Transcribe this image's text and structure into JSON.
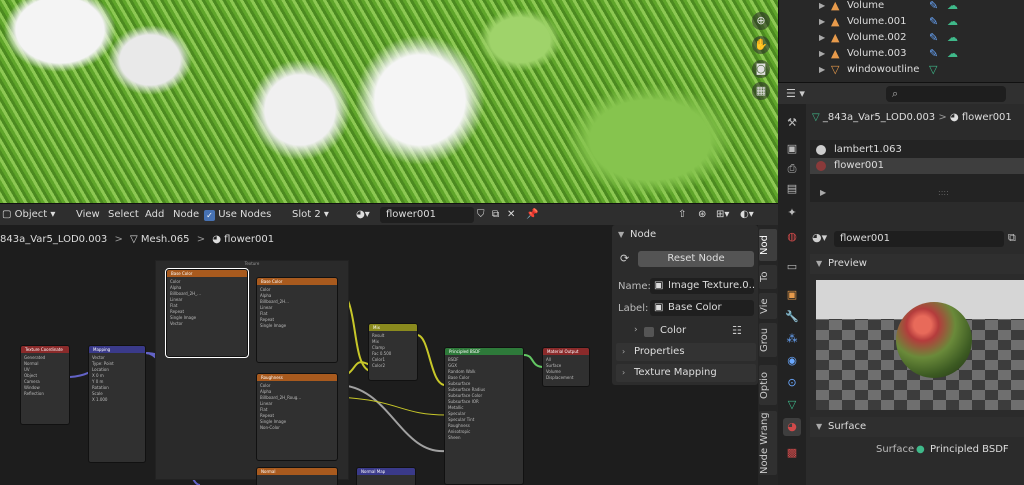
{
  "outliner": {
    "items": [
      {
        "label": "Volume"
      },
      {
        "label": "Volume.001"
      },
      {
        "label": "Volume.002"
      },
      {
        "label": "Volume.003"
      },
      {
        "label": "windowoutline"
      }
    ]
  },
  "properties": {
    "search_placeholder": "",
    "path_object": "_843a_Var5_LOD0.003",
    "path_material": "flower001",
    "materials": [
      {
        "name": "lambert1.063",
        "color": "#cccccc"
      },
      {
        "name": "flower001",
        "color": "#8a3a3a"
      }
    ],
    "material_slot": "flower001",
    "preview_label": "Preview",
    "surface_section": "Surface",
    "surface_label": "Surface",
    "surface_value": "Principled BSDF"
  },
  "node_editor": {
    "mode": "Object",
    "menu": [
      "View",
      "Select",
      "Add",
      "Node"
    ],
    "use_nodes_label": "Use Nodes",
    "slot": "Slot 2",
    "material": "flower001",
    "breadcrumb": {
      "object": "843a_Var5_LOD0.003",
      "mesh": "Mesh.065",
      "material": "flower001"
    },
    "frame_label": "Texture",
    "nodes": {
      "tex_coord": "Texture Coordinate",
      "mapping": "Mapping",
      "base_color": "Base Color",
      "roughness": "Roughness",
      "mix": "Mix",
      "bsdf": "Principled BSDF",
      "output": "Material Output",
      "normal": "Normal",
      "normal_map": "Normal Map"
    }
  },
  "npanel": {
    "node_section": "Node",
    "reset_label": "Reset Node",
    "name_label": "Name:",
    "name_value": "Image Texture.0...",
    "label_label": "Label:",
    "label_value": "Base Color",
    "color_label": "Color",
    "properties_label": "Properties",
    "texture_mapping_label": "Texture Mapping"
  },
  "vtabs": [
    "Nod",
    "To",
    "Vie",
    "Grou",
    "Optio",
    "Node Wrang"
  ],
  "colors": {
    "accent": "#4772b3",
    "node_orange": "#a85a1e",
    "node_green": "#2e7a3a",
    "node_red": "#8a2a2a",
    "node_yellow": "#8a8a1e",
    "node_purple": "#3a3a8a"
  }
}
